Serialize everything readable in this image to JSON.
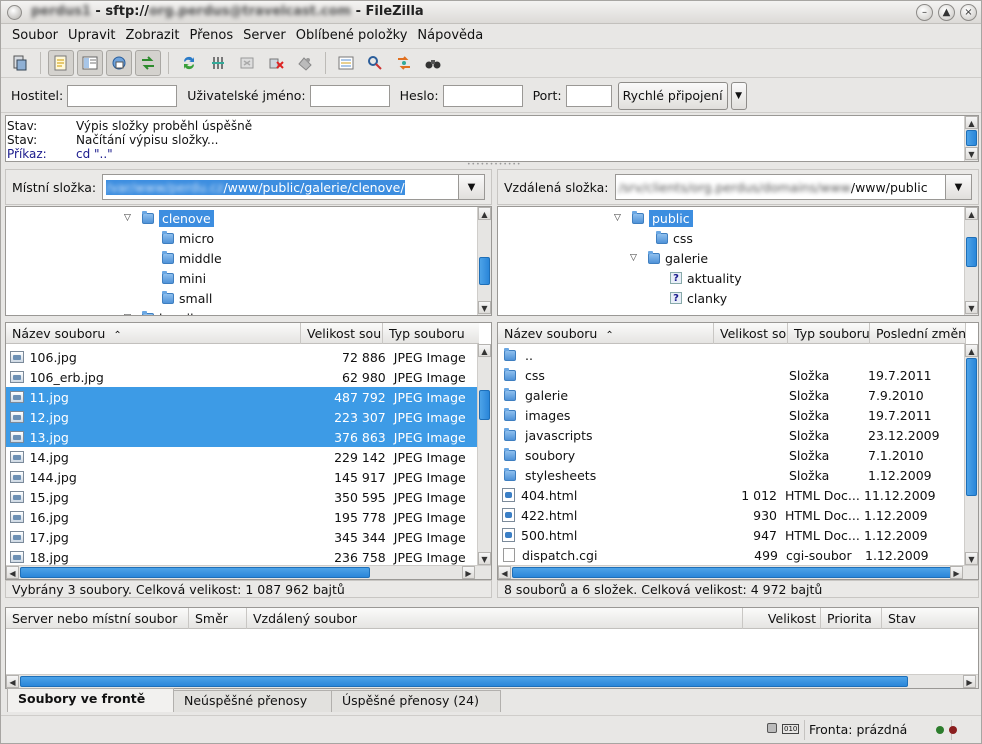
{
  "window": {
    "title_blurred_prefix": "perdus1",
    "title_middle": " - sftp://",
    "title_blurred_host": "org.perdus@travelcast.com",
    "title_suffix": " - FileZilla"
  },
  "menu": [
    "Soubor",
    "Upravit",
    "Zobrazit",
    "Přenos",
    "Server",
    "Oblíbené položky",
    "Nápověda"
  ],
  "quickconnect": {
    "host_label": "Hostitel:",
    "user_label": "Uživatelské jméno:",
    "pass_label": "Heslo:",
    "port_label": "Port:",
    "connect_button": "Rychlé připojení",
    "host_value": "",
    "user_value": "",
    "pass_value": "",
    "port_value": ""
  },
  "log": [
    {
      "type": "Stav:",
      "text": "Výpis složky proběhl úspěšně",
      "cmd": false
    },
    {
      "type": "Stav:",
      "text": "Načítání výpisu složky...",
      "cmd": false
    },
    {
      "type": "Příkaz:",
      "text": "cd \"..\"",
      "cmd": true
    }
  ],
  "local": {
    "path_label": "Místní složka:",
    "path_blurred": "/var/www/perdu.cz",
    "path_visible": "/www/public/galerie/clenove/",
    "tree": [
      {
        "label": "clenove",
        "selected": true,
        "expander": "▽",
        "icon": "folder"
      },
      {
        "label": "micro",
        "selected": false,
        "expander": "",
        "icon": "folder"
      },
      {
        "label": "middle",
        "selected": false,
        "expander": "",
        "icon": "folder"
      },
      {
        "label": "mini",
        "selected": false,
        "expander": "",
        "icon": "folder"
      },
      {
        "label": "small",
        "selected": false,
        "expander": "",
        "icon": "folder"
      },
      {
        "label": "kronika",
        "selected": false,
        "expander": "▽",
        "icon": "folder"
      }
    ],
    "columns": [
      "Název souboru",
      "Velikost sou",
      "Typ souboru"
    ],
    "files": [
      {
        "name": "106.jpg",
        "size": "72 886",
        "type": "JPEG Image",
        "selected": false
      },
      {
        "name": "106_erb.jpg",
        "size": "62 980",
        "type": "JPEG Image",
        "selected": false
      },
      {
        "name": "11.jpg",
        "size": "487 792",
        "type": "JPEG Image",
        "selected": true
      },
      {
        "name": "12.jpg",
        "size": "223 307",
        "type": "JPEG Image",
        "selected": true
      },
      {
        "name": "13.jpg",
        "size": "376 863",
        "type": "JPEG Image",
        "selected": true
      },
      {
        "name": "14.jpg",
        "size": "229 142",
        "type": "JPEG Image",
        "selected": false
      },
      {
        "name": "144.jpg",
        "size": "145 917",
        "type": "JPEG Image",
        "selected": false
      },
      {
        "name": "15.jpg",
        "size": "350 595",
        "type": "JPEG Image",
        "selected": false
      },
      {
        "name": "16.jpg",
        "size": "195 778",
        "type": "JPEG Image",
        "selected": false
      },
      {
        "name": "17.jpg",
        "size": "345 344",
        "type": "JPEG Image",
        "selected": false
      },
      {
        "name": "18.jpg",
        "size": "236 758",
        "type": "JPEG Image",
        "selected": false
      }
    ],
    "status": "Vybrány 3 soubory. Celková velikost: 1 087 962 bajtů"
  },
  "remote": {
    "path_label": "Vzdálená složka:",
    "path_blurred": "/srv/clients/org.perdus/domains/www",
    "path_visible": "/www/public",
    "tree": [
      {
        "label": "public",
        "selected": true,
        "expander": "▽",
        "icon": "folder"
      },
      {
        "label": "css",
        "selected": false,
        "expander": "",
        "icon": "folder"
      },
      {
        "label": "galerie",
        "selected": false,
        "expander": "▽",
        "icon": "folder"
      },
      {
        "label": "aktuality",
        "selected": false,
        "expander": "",
        "icon": "question"
      },
      {
        "label": "clanky",
        "selected": false,
        "expander": "",
        "icon": "question"
      }
    ],
    "columns": [
      "Název souboru",
      "Velikost sou",
      "Typ souboru",
      "Poslední změna"
    ],
    "files": [
      {
        "name": "..",
        "size": "",
        "type": "",
        "date": "",
        "icon": "folder"
      },
      {
        "name": "css",
        "size": "",
        "type": "Složka",
        "date": "19.7.2011",
        "icon": "folder"
      },
      {
        "name": "galerie",
        "size": "",
        "type": "Složka",
        "date": "7.9.2010",
        "icon": "folder"
      },
      {
        "name": "images",
        "size": "",
        "type": "Složka",
        "date": "19.7.2011",
        "icon": "folder"
      },
      {
        "name": "javascripts",
        "size": "",
        "type": "Složka",
        "date": "23.12.2009",
        "icon": "folder"
      },
      {
        "name": "soubory",
        "size": "",
        "type": "Složka",
        "date": "7.1.2010",
        "icon": "folder"
      },
      {
        "name": "stylesheets",
        "size": "",
        "type": "Složka",
        "date": "1.12.2009",
        "icon": "folder"
      },
      {
        "name": "404.html",
        "size": "1 012",
        "type": "HTML Doc...",
        "date": "11.12.2009",
        "icon": "html"
      },
      {
        "name": "422.html",
        "size": "930",
        "type": "HTML Doc...",
        "date": "1.12.2009",
        "icon": "html"
      },
      {
        "name": "500.html",
        "size": "947",
        "type": "HTML Doc...",
        "date": "1.12.2009",
        "icon": "html"
      },
      {
        "name": "dispatch.cgi",
        "size": "499",
        "type": "cgi-soubor",
        "date": "1.12.2009",
        "icon": "file"
      }
    ],
    "status": "8 souborů a 6 složek. Celková velikost: 4 972 bajtů"
  },
  "queue": {
    "columns": [
      "Server nebo místní soubor",
      "Směr",
      "Vzdálený soubor",
      "Velikost",
      "Priorita",
      "Stav"
    ],
    "tabs": [
      "Soubory ve frontě",
      "Neúspěšné přenosy",
      "Úspěšné přenosy (24)"
    ]
  },
  "statusbar": {
    "queue_text": "Fronta: prázdná"
  }
}
